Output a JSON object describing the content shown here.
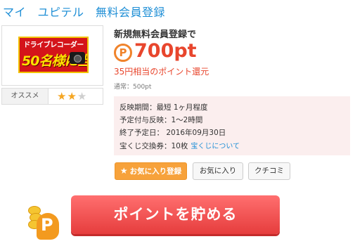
{
  "header": {
    "title": "マイ　ユピテル　無料会員登録"
  },
  "banner": {
    "top_text": "ドライブレコーダー",
    "big_text": "50名様に当たる"
  },
  "recommend": {
    "label": "オススメ",
    "rating": 2,
    "max_rating": 3
  },
  "promo": {
    "headline": "新規無料会員登録で",
    "points_icon": "P",
    "points": "700pt",
    "yen_equivalent": "35円相当のポイント還元",
    "normal": "通常：500pt"
  },
  "info": {
    "reflect_period": "反映期間：最短 1ヶ月程度",
    "scheduled": "予定付与反映：1～2時間",
    "end_date": "終了予定日： 2016年09月30日",
    "lottery": "宝くじ交換券：10枚",
    "lottery_link": "宝くじについて"
  },
  "buttons": {
    "favorite_register": "お気に入り登録",
    "favorite": "お気に入り",
    "reviews": "クチコミ",
    "cta": "ポイントを貯める"
  },
  "colors": {
    "accent": "#e8462d",
    "link": "#1f8fd6",
    "cta": "#f05252",
    "fav_button": "#f7a23b"
  }
}
